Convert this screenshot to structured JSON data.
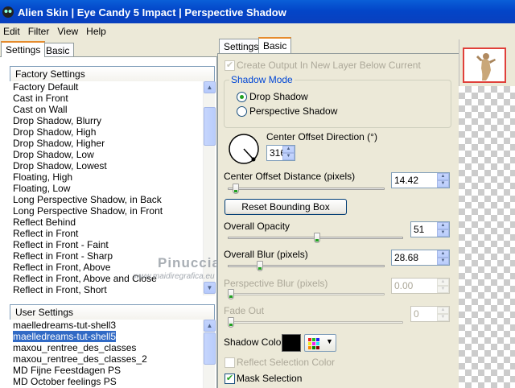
{
  "window": {
    "title": "Alien Skin | Eye Candy 5 Impact | Perspective Shadow"
  },
  "menu": [
    "Edit",
    "Filter",
    "View",
    "Help"
  ],
  "left_tabs": [
    "Settings",
    "Basic"
  ],
  "factory_settings": {
    "header": "Factory Settings",
    "items": [
      "Factory Default",
      "Cast in Front",
      "Cast on Wall",
      "Drop Shadow, Blurry",
      "Drop Shadow, High",
      "Drop Shadow, Higher",
      "Drop Shadow, Low",
      "Drop Shadow, Lowest",
      "Floating, High",
      "Floating, Low",
      "Long Perspective Shadow, in Back",
      "Long Perspective Shadow, in Front",
      "Reflect Behind",
      "Reflect in Front",
      "Reflect in Front - Faint",
      "Reflect in Front - Sharp",
      "Reflect in Front, Above",
      "Reflect in Front, Above and Close",
      "Reflect in Front, Short"
    ]
  },
  "user_settings": {
    "header": "User Settings",
    "items": [
      "maelledreams-tut-shell3",
      "maelledreams-tut-shell5",
      "maxou_rentree_des_classes",
      "maxou_rentree_des_classes_2",
      "MD Fijne Feestdagen PS",
      "MD October feelings PS"
    ],
    "selected_index": 1
  },
  "right_tabs": [
    "Settings",
    "Basic"
  ],
  "basic": {
    "create_output_label": "Create Output In New Layer Below Current",
    "create_output_checked": true,
    "shadow_mode_legend": "Shadow Mode",
    "shadow_mode_options": [
      "Drop Shadow",
      "Perspective Shadow"
    ],
    "shadow_mode_selected": 0,
    "center_offset_direction_label": "Center Offset Direction (°)",
    "center_offset_direction_value": "316",
    "center_offset_distance_label": "Center Offset Distance (pixels)",
    "center_offset_distance_value": "14.42",
    "center_offset_distance_level": 0.03,
    "reset_button": "Reset Bounding Box",
    "overall_opacity_label": "Overall Opacity",
    "overall_opacity_value": "51",
    "overall_opacity_level": 0.51,
    "overall_blur_label": "Overall Blur (pixels)",
    "overall_blur_value": "28.68",
    "overall_blur_level": 0.19,
    "perspective_blur_label": "Perspective Blur (pixels)",
    "perspective_blur_value": "0.00",
    "perspective_blur_level": 0,
    "fade_out_label": "Fade Out",
    "fade_out_value": "0",
    "fade_out_level": 0,
    "shadow_color_label": "Shadow Color",
    "shadow_color": "#000000",
    "reflect_selection_color_label": "Reflect Selection Color",
    "reflect_selection_color_checked": false,
    "mask_selection_label": "Mask Selection",
    "mask_selection_checked": true
  },
  "watermark": {
    "line1": "Pinuccia",
    "line2": "www.maidiregrafica.eu"
  },
  "colors": {
    "title_bar": "#0345c8",
    "selection": "#316ac5",
    "check_green": "#21a121",
    "group_legend": "#0046d5"
  }
}
